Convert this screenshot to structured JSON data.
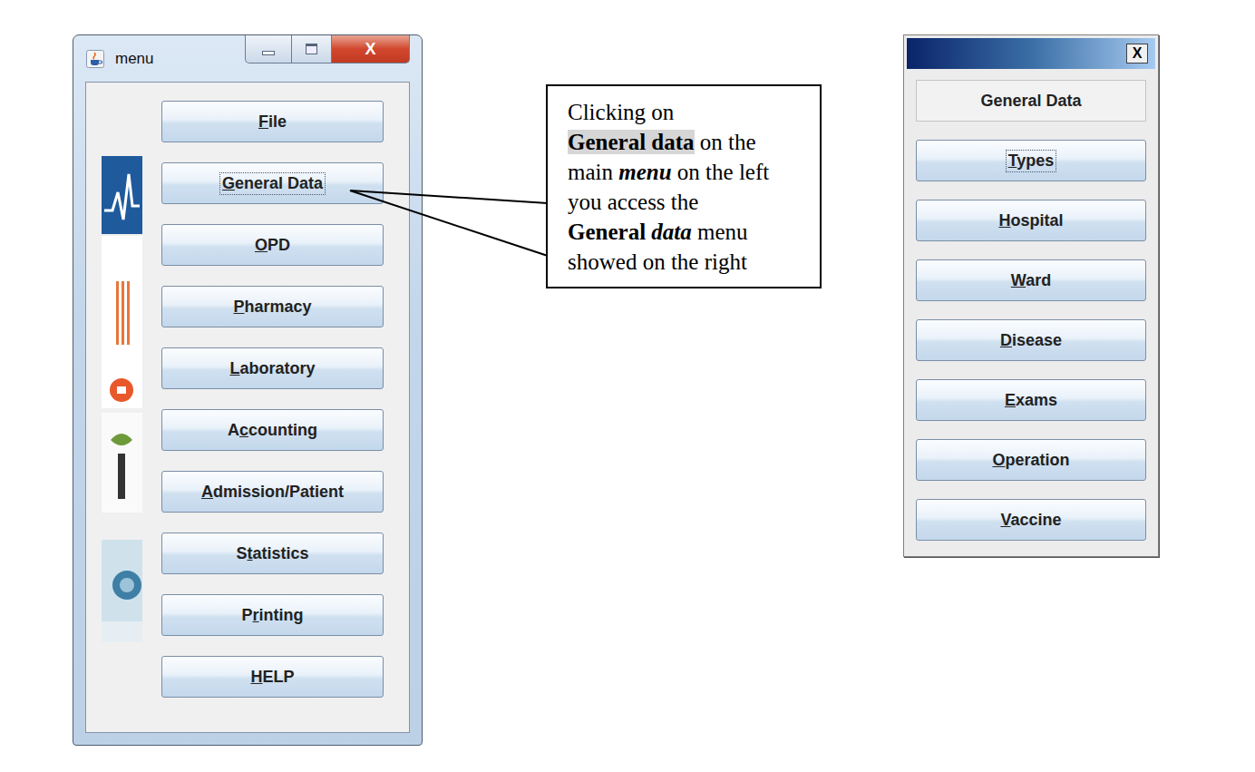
{
  "main_window": {
    "title": "menu",
    "close": "X",
    "buttons": [
      {
        "label": "File",
        "mnemonic": 0,
        "focused": false
      },
      {
        "label": "General Data",
        "mnemonic": 0,
        "focused": true
      },
      {
        "label": "OPD",
        "mnemonic": 0,
        "focused": false
      },
      {
        "label": "Pharmacy",
        "mnemonic": 0,
        "focused": false
      },
      {
        "label": "Laboratory",
        "mnemonic": 0,
        "focused": false
      },
      {
        "label": "Accounting",
        "mnemonic": 1,
        "focused": false
      },
      {
        "label": "Admission/Patient",
        "mnemonic": 0,
        "focused": false
      },
      {
        "label": "Statistics",
        "mnemonic": 1,
        "focused": false
      },
      {
        "label": "Printing",
        "mnemonic": 1,
        "focused": false
      },
      {
        "label": "HELP",
        "mnemonic": 0,
        "focused": false
      }
    ]
  },
  "callout": {
    "lines": [
      [
        {
          "text": "Clicking on",
          "bold": false,
          "italic": false,
          "highlight": false
        }
      ],
      [
        {
          "text": "General data",
          "bold": true,
          "italic": false,
          "highlight": true
        },
        {
          "text": " on the",
          "bold": false,
          "italic": false,
          "highlight": false
        }
      ],
      [
        {
          "text": "main ",
          "bold": false,
          "italic": false,
          "highlight": false
        },
        {
          "text": "menu",
          "bold": true,
          "italic": true,
          "highlight": false
        },
        {
          "text": " on the left",
          "bold": false,
          "italic": false,
          "highlight": false
        }
      ],
      [
        {
          "text": "you access the",
          "bold": false,
          "italic": false,
          "highlight": false
        }
      ],
      [
        {
          "text": "General ",
          "bold": true,
          "italic": false,
          "highlight": false
        },
        {
          "text": "data",
          "bold": true,
          "italic": true,
          "highlight": false
        },
        {
          "text": " menu",
          "bold": false,
          "italic": false,
          "highlight": false
        }
      ],
      [
        {
          "text": "showed on the right",
          "bold": false,
          "italic": false,
          "highlight": false
        }
      ]
    ]
  },
  "sub_window": {
    "title": "General Data",
    "close": "X",
    "buttons": [
      {
        "label": "Types",
        "mnemonic": 0,
        "focused": true
      },
      {
        "label": "Hospital",
        "mnemonic": 0,
        "focused": false
      },
      {
        "label": "Ward",
        "mnemonic": 0,
        "focused": false
      },
      {
        "label": "Disease",
        "mnemonic": 0,
        "focused": false
      },
      {
        "label": "Exams",
        "mnemonic": 0,
        "focused": false
      },
      {
        "label": "Operation",
        "mnemonic": 0,
        "focused": false
      },
      {
        "label": "Vaccine",
        "mnemonic": 0,
        "focused": false
      }
    ]
  }
}
